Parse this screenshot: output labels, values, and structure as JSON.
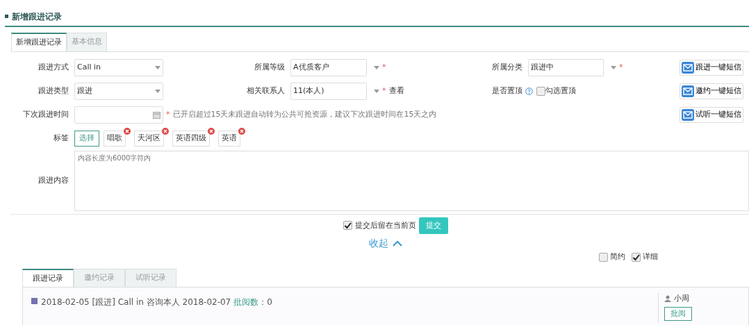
{
  "page_title": "新增跟进记录",
  "tabs": [
    {
      "label": "新增跟进记录",
      "selected": true
    },
    {
      "label": "基本信息",
      "selected": false
    }
  ],
  "form_rows": [
    {
      "cells": [
        {
          "kind": "select",
          "label": "跟进方式",
          "value": "Call in"
        },
        {
          "kind": "select",
          "label": "所属等级",
          "value": "A优质客户",
          "required_mark": "*"
        },
        {
          "kind": "select",
          "label": "所属分类",
          "value": "跟进中",
          "required_mark": "*"
        }
      ],
      "sms_button": "跟进一键短信"
    },
    {
      "cells": [
        {
          "kind": "select",
          "label": "跟进类型",
          "value": "跟进"
        },
        {
          "kind": "select",
          "label": "相关联系人",
          "value": "11(本人)",
          "required_mark": "*",
          "link": "查看"
        },
        {
          "kind": "checkbox",
          "label": "是否置顶",
          "option": "勾选置顶",
          "checked": false
        }
      ],
      "sms_button": "邀约一键短信"
    },
    {
      "cells": [
        {
          "kind": "date",
          "label": "下次跟进时间",
          "required_mark": "*",
          "note": "已开启超过15天未跟进自动转为公共可抢资源，建议下次跟进时间在15天之内"
        }
      ],
      "sms_button": "试听一键短信"
    }
  ],
  "tags": {
    "label": "标签",
    "select_button": "选择",
    "items": [
      "唱歌",
      "天河区",
      "英语四级",
      "英语"
    ]
  },
  "content": {
    "label": "跟进内容",
    "placeholder": "内容长度为6000字符内"
  },
  "stay_checkbox": {
    "label": "提交后留在当前页",
    "checked": true
  },
  "submit_button": "提交",
  "collapse_link": "收起",
  "view_options": [
    {
      "label": "简约",
      "checked": false
    },
    {
      "label": "详细",
      "checked": true
    }
  ],
  "record_tabs": [
    {
      "label": "跟进记录",
      "selected": true
    },
    {
      "label": "邀约记录",
      "selected": false
    },
    {
      "label": "试听记录",
      "selected": false
    }
  ],
  "records": [
    {
      "color": "#7272b0",
      "text": "2018-02-05 [跟进] Call in 咨询本人 2018-02-07",
      "review_label": "批阅数",
      "review_value": "：0",
      "user": "小周",
      "review_button": "批阅"
    }
  ]
}
